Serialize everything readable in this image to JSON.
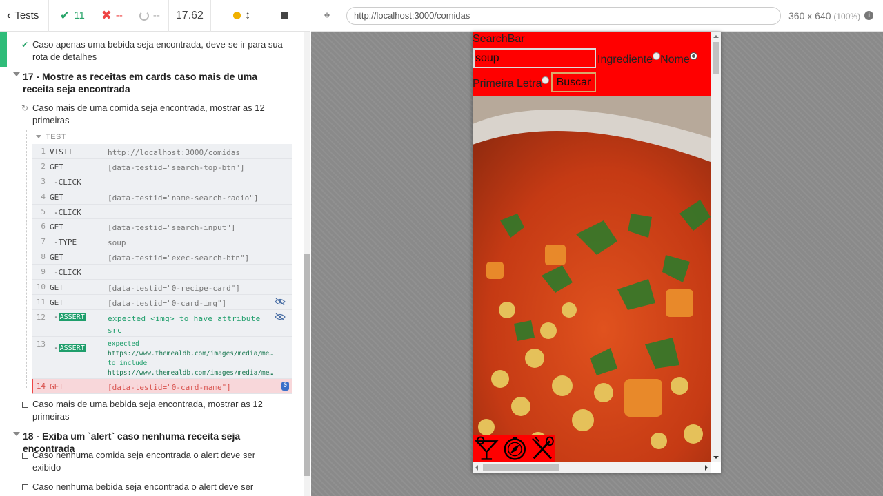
{
  "reporter": {
    "tests_label": "Tests",
    "passed": "11",
    "failed": "--",
    "pending": "--",
    "duration": "17.62"
  },
  "tests": {
    "prev_test": "Caso apenas uma bebida seja encontrada, deve-se ir para sua rota de detalhes",
    "suite17": "17 - Mostre as receitas em cards caso mais de uma receita seja encontrada",
    "running_test": "Caso mais de uma comida seja encontrada, mostrar as 12 primeiras",
    "cmd_section": "TEST",
    "commands": [
      {
        "num": "1",
        "name": "VISIT",
        "msg": "http://localhost:3000/comidas"
      },
      {
        "num": "2",
        "name": "GET",
        "msg": "[data-testid=\"search-top-btn\"]"
      },
      {
        "num": "3",
        "name": "-CLICK",
        "msg": ""
      },
      {
        "num": "4",
        "name": "GET",
        "msg": "[data-testid=\"name-search-radio\"]"
      },
      {
        "num": "5",
        "name": "-CLICK",
        "msg": ""
      },
      {
        "num": "6",
        "name": "GET",
        "msg": "[data-testid=\"search-input\"]"
      },
      {
        "num": "7",
        "name": "-TYPE",
        "msg": "soup"
      },
      {
        "num": "8",
        "name": "GET",
        "msg": "[data-testid=\"exec-search-btn\"]"
      },
      {
        "num": "9",
        "name": "-CLICK",
        "msg": ""
      },
      {
        "num": "10",
        "name": "GET",
        "msg": "[data-testid=\"0-recipe-card\"]"
      },
      {
        "num": "11",
        "name": "GET",
        "msg": "[data-testid=\"0-card-img\"]"
      }
    ],
    "assert12": {
      "num": "12",
      "badge": "ASSERT",
      "msg": "expected <img> to have attribute src"
    },
    "assert13": {
      "num": "13",
      "badge": "ASSERT",
      "line1": "expected",
      "line2": "https://www.themealdb.com/images/media/me…",
      "line3": "to include",
      "line4": "https://www.themealdb.com/images/media/me…"
    },
    "failed_cmd": {
      "num": "14",
      "name": "GET",
      "msg": "[data-testid=\"0-card-name\"]",
      "badge": "0"
    },
    "next_test": "Caso mais de uma bebida seja encontrada, mostrar as 12 primeiras",
    "suite18": "18 - Exiba um `alert` caso nenhuma receita seja encontrada",
    "test18a": "Caso nenhuma comida seja encontrada o alert deve ser exibido",
    "test18b": "Caso nenhuma bebida seja encontrada o alert deve ser"
  },
  "aut": {
    "url": "http://localhost:3000/comidas",
    "viewport": "360 x 640",
    "zoom": "(100%)"
  },
  "app": {
    "searchbar_title": "SearchBar",
    "search_value": "soup",
    "radio_ingredient": "Ingrediente",
    "radio_name": "Nome",
    "radio_first_letter": "Primeira Letra",
    "search_button": "Buscar",
    "selected_radio": "Nome"
  },
  "colors": {
    "pass": "#2aa56b",
    "fail": "#e44",
    "app_red": "#ff0000"
  }
}
